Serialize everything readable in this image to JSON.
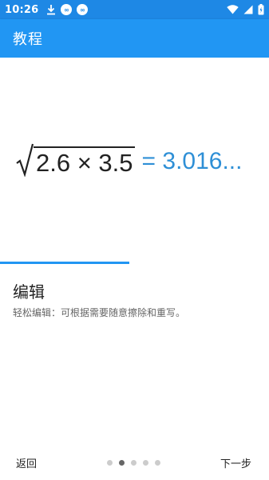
{
  "status_bar": {
    "time": "10:26",
    "left_icons": [
      "download-icon",
      "app-badge-icon",
      "app-badge-icon"
    ],
    "badge_text": "∞",
    "right_icons": [
      "wifi-icon",
      "cellular-signal-icon",
      "battery-charging-icon"
    ]
  },
  "app_bar": {
    "title": "教程"
  },
  "demo": {
    "radicand": "2.6 × 3.5",
    "result": "= 3.016..."
  },
  "progress": {
    "fraction": 0.48
  },
  "section": {
    "title": "编辑",
    "description": "轻松编辑：可根据需要随意擦除和重写。"
  },
  "footer": {
    "back_label": "返回",
    "next_label": "下一步",
    "dots_total": 5,
    "dots_active_index": 1
  },
  "colors": {
    "status_bar": "#1e88e5",
    "app_bar": "#2196f3",
    "result_text": "#2e8fd6"
  }
}
